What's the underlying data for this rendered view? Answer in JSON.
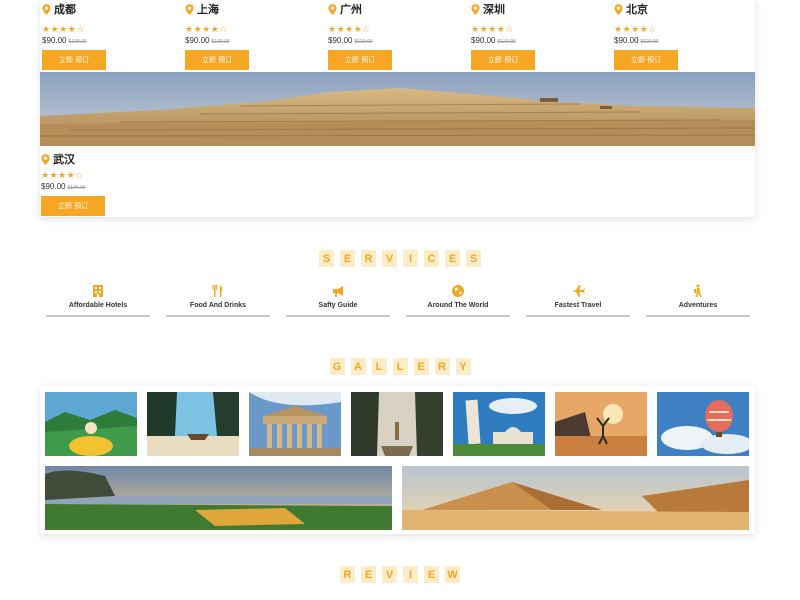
{
  "destinations": [
    {
      "city": "成都",
      "desc": "",
      "stars": "★★★★☆",
      "price": "$90.00",
      "old_price": "$120.00",
      "button": "立即 预订"
    },
    {
      "city": "上海",
      "desc": "",
      "stars": "★★★★☆",
      "price": "$90.00",
      "old_price": "$120.00",
      "button": "立即 预订"
    },
    {
      "city": "广州",
      "desc": "",
      "stars": "★★★★☆",
      "price": "$90.00",
      "old_price": "$120.00",
      "button": "立即 预订"
    },
    {
      "city": "深圳",
      "desc": "",
      "stars": "★★★★☆",
      "price": "$90.00",
      "old_price": "$120.00",
      "button": "立即 预订"
    },
    {
      "city": "北京",
      "desc": "",
      "stars": "★★★★☆",
      "price": "$90.00",
      "old_price": "$120.00",
      "button": "立即 预订"
    }
  ],
  "featured": {
    "city": "武汉",
    "desc": "",
    "stars": "★★★★☆",
    "price": "$90.00",
    "old_price": "$120.00",
    "button": "立即 预订"
  },
  "services_title": [
    "S",
    "E",
    "R",
    "V",
    "I",
    "C",
    "E",
    "S"
  ],
  "services": [
    {
      "label": "Affordable Hotels",
      "icon": "hotel-icon"
    },
    {
      "label": "Food And Drinks",
      "icon": "food-drinks-icon"
    },
    {
      "label": "Safty Guide",
      "icon": "megaphone-icon"
    },
    {
      "label": "Around The World",
      "icon": "globe-icon"
    },
    {
      "label": "Fastest Travel",
      "icon": "airplane-icon"
    },
    {
      "label": "Adventures",
      "icon": "hiker-icon"
    }
  ],
  "gallery_title": [
    "G",
    "A",
    "L",
    "L",
    "E",
    "R",
    "Y"
  ],
  "review_title": [
    "R",
    "E",
    "V",
    "I",
    "E",
    "W"
  ],
  "colors": {
    "accent": "#f5a623",
    "accent_light": "#fdecc8"
  }
}
